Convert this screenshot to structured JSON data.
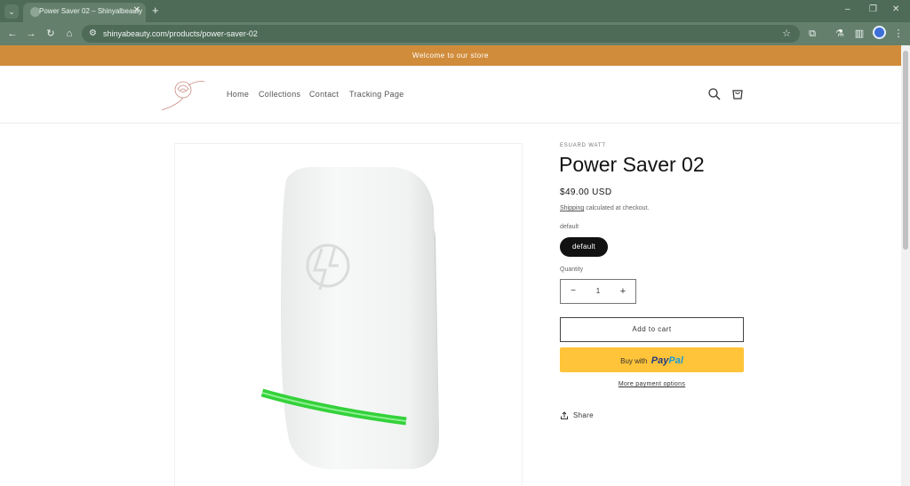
{
  "browser": {
    "tab_title": "Power Saver 02 – Shinyalbeauty",
    "tab_close": "✕",
    "new_tab": "+",
    "url": "shinyabeauty.com/products/power-saver-02",
    "window_controls": [
      "–",
      "❐",
      "✕"
    ]
  },
  "store": {
    "announcement": "Welcome to our store",
    "nav": [
      "Home",
      "Collections",
      "Contact",
      "Tracking Page"
    ],
    "logo_text": "SHINYABEAUTY"
  },
  "product": {
    "vendor": "ESUARD WATT",
    "title": "Power Saver 02",
    "price": "$49.00 USD",
    "shipping_link": "Shipping",
    "tax_note": " calculated at checkout.",
    "variant_label": "default",
    "variant_selected": "default",
    "quantity_label": "Quantity",
    "quantity": "1",
    "qty_minus": "−",
    "qty_plus": "+",
    "add_to_cart": "Add to cart",
    "paypal_prefix": "Buy with",
    "paypal_pay": "Pay",
    "paypal_pal": "Pal",
    "more_payment": "More payment options",
    "share": "Share"
  },
  "colors": {
    "announcement_bar": "#d08c3b",
    "paypal_yellow": "#ffc439",
    "browser_frame": "#64806d",
    "led_green": "#33d13a"
  }
}
